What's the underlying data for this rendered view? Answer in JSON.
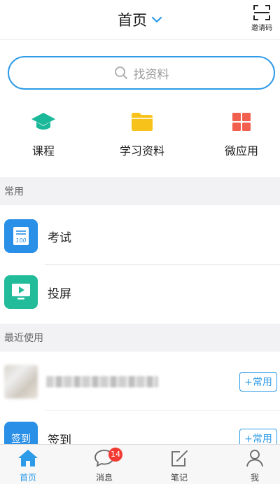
{
  "header": {
    "title": "首页",
    "invite_label": "邀请码"
  },
  "search": {
    "placeholder": "找资料"
  },
  "quick_actions": [
    {
      "label": "课程",
      "icon": "graduation-cap-icon",
      "color": "#1bb89a"
    },
    {
      "label": "学习资料",
      "icon": "folder-icon",
      "color": "#f7c21a"
    },
    {
      "label": "微应用",
      "icon": "grid-apps-icon",
      "color": "#f1604f"
    }
  ],
  "sections": {
    "common": {
      "title": "常用",
      "items": [
        {
          "label": "考试",
          "icon": "exam-icon",
          "color": "#2a8fe6",
          "icon_text": "100"
        },
        {
          "label": "投屏",
          "icon": "screen-cast-icon",
          "color": "#22bc9b"
        }
      ]
    },
    "recent": {
      "title": "最近使用",
      "items": [
        {
          "label": "",
          "add_label": "+常用"
        },
        {
          "label": "签到",
          "icon_text": "签到",
          "icon_color": "#2a8fe6",
          "add_label": "+常用"
        }
      ]
    }
  },
  "tabbar": {
    "items": [
      {
        "label": "首页",
        "icon": "home-icon",
        "active": true
      },
      {
        "label": "消息",
        "icon": "message-icon",
        "badge": "14"
      },
      {
        "label": "笔记",
        "icon": "note-icon"
      },
      {
        "label": "我",
        "icon": "profile-icon"
      }
    ]
  },
  "colors": {
    "accent": "#2e9be8",
    "badge": "#f23a32",
    "inactive": "#666666"
  }
}
